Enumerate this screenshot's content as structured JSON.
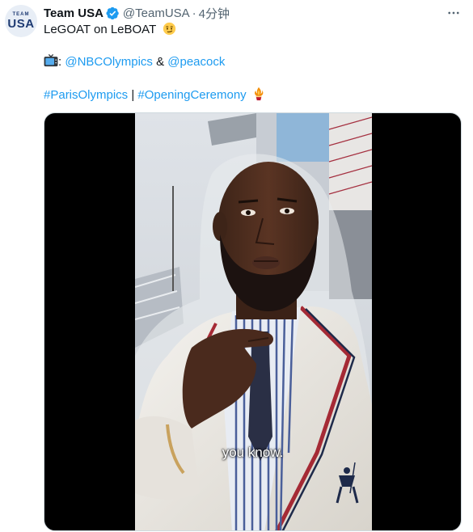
{
  "account": {
    "avatar_text_small": "TEAM",
    "avatar_text_big": "USA",
    "name": "Team USA",
    "handle": "@TeamUSA",
    "time_separator": "·",
    "time": "4分钟"
  },
  "tweet": {
    "text": "LeGOAT on LeBOAT",
    "mention_prefix": ":",
    "mention_nbc": "@NBCOlympics",
    "mention_joiner": " & ",
    "mention_peacock": "@peacock",
    "hashtag_paris": "#ParisOlympics",
    "hashtag_separator": " | ",
    "hashtag_opening": "#OpeningCeremony"
  },
  "video": {
    "caption": "you know."
  },
  "icons": {
    "verified": "verified-badge-icon",
    "more": "more-options-icon",
    "emoji": "smirking-face-emoji",
    "tv": "television-icon",
    "flame": "olympic-flame-icon"
  },
  "colors": {
    "link": "#1d9bf0",
    "text": "#0f1419",
    "muted": "#536471",
    "verified": "#1d9bf0"
  }
}
